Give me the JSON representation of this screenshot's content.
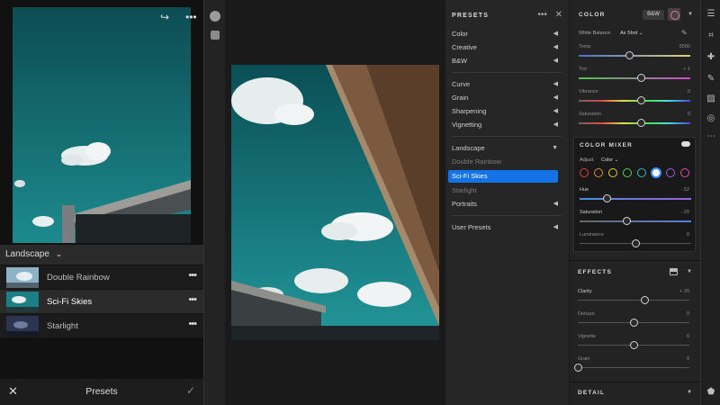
{
  "mobile": {
    "group_label": "Landscape",
    "presets": [
      {
        "label": "Double Rainbow",
        "active": false
      },
      {
        "label": "Sci-Fi Skies",
        "active": true
      },
      {
        "label": "Starlight",
        "active": false
      }
    ],
    "bottom_title": "Presets",
    "dots": "•••"
  },
  "presets_panel": {
    "title": "PRESETS",
    "header_dots": "•••",
    "items": [
      {
        "label": "Color",
        "arrow": "◀"
      },
      {
        "label": "Creative",
        "arrow": "◀"
      },
      {
        "label": "B&W",
        "arrow": "◀"
      },
      {
        "label": "Curve",
        "arrow": "◀"
      },
      {
        "label": "Grain",
        "arrow": "◀"
      },
      {
        "label": "Sharpening",
        "arrow": "◀"
      },
      {
        "label": "Vignetting",
        "arrow": "◀"
      },
      {
        "label": "Landscape",
        "arrow": "▼"
      },
      {
        "label": "Double Rainbow"
      },
      {
        "label": "Sci-Fi Skies"
      },
      {
        "label": "Starlight"
      },
      {
        "label": "Portraits",
        "arrow": "◀"
      },
      {
        "label": "User Presets",
        "arrow": "◀"
      }
    ]
  },
  "edit_panel": {
    "color_title": "COLOR",
    "bw_label": "B&W",
    "white_balance_label": "White Balance",
    "white_balance_value": "As Shot",
    "sliders": [
      {
        "label": "Temp",
        "value": "5500",
        "pos": 0.4
      },
      {
        "label": "Tint",
        "value": "+ 1",
        "pos": 0.5
      },
      {
        "label": "Vibrance",
        "value": "0",
        "pos": 0.5
      },
      {
        "label": "Saturation",
        "value": "0",
        "pos": 0.5
      }
    ],
    "mixer_title": "COLOR MIXER",
    "adjust_label": "Adjust",
    "adjust_value": "Color",
    "mixer_colors": [
      "#e03a3a",
      "#e08a2a",
      "#e0d02a",
      "#5ad04a",
      "#2ac0b0",
      "#3d8cff",
      "#9b5fe0",
      "#e04aa8"
    ],
    "mixer_sliders": [
      {
        "label": "Hue",
        "value": "- 52",
        "pos": 0.24
      },
      {
        "label": "Saturation",
        "value": "- 20",
        "pos": 0.4
      },
      {
        "label": "Luminance",
        "value": "0",
        "pos": 0.5
      }
    ],
    "effects_title": "EFFECTS",
    "effects_sliders": [
      {
        "label": "Clarity",
        "value": "+ 20",
        "pos": 0.6
      },
      {
        "label": "Dehaze",
        "value": "0",
        "pos": 0.5
      },
      {
        "label": "Vignette",
        "value": "0",
        "pos": 0.5
      },
      {
        "label": "Grain",
        "value": "0",
        "pos": 0.0
      }
    ],
    "detail_title": "DETAIL"
  }
}
